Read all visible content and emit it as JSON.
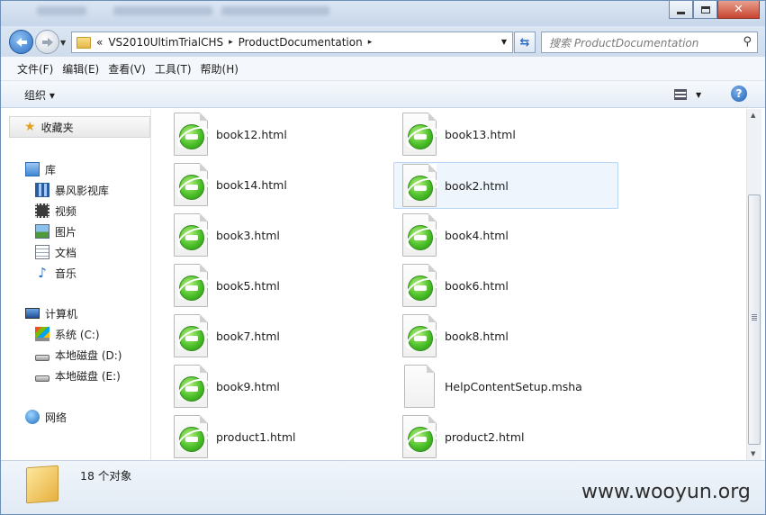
{
  "titlebar": {
    "minimize_icon": "minimize-icon",
    "maximize_icon": "maximize-icon",
    "close_icon": "close-icon"
  },
  "address": {
    "chevrons": "«",
    "crumbs": [
      "VS2010UltimTrialCHS",
      "ProductDocumentation"
    ],
    "separator": "▸"
  },
  "search": {
    "placeholder": "搜索 ProductDocumentation"
  },
  "menu": {
    "file": "文件(F)",
    "edit": "编辑(E)",
    "view": "查看(V)",
    "tools": "工具(T)",
    "help": "帮助(H)"
  },
  "toolbar": {
    "organize": "组织 ▾"
  },
  "nav": {
    "favorites": "收藏夹",
    "libraries": "库",
    "lib_items": [
      "暴风影视库",
      "视频",
      "图片",
      "文档",
      "音乐"
    ],
    "computer": "计算机",
    "drives": [
      "系统 (C:)",
      "本地磁盘 (D:)",
      "本地磁盘 (E:)"
    ],
    "network": "网络"
  },
  "files": [
    {
      "name": "book12.html",
      "type": "html"
    },
    {
      "name": "book13.html",
      "type": "html"
    },
    {
      "name": "book14.html",
      "type": "html"
    },
    {
      "name": "book2.html",
      "type": "html",
      "selected": true
    },
    {
      "name": "book3.html",
      "type": "html"
    },
    {
      "name": "book4.html",
      "type": "html"
    },
    {
      "name": "book5.html",
      "type": "html"
    },
    {
      "name": "book6.html",
      "type": "html"
    },
    {
      "name": "book7.html",
      "type": "html"
    },
    {
      "name": "book8.html",
      "type": "html"
    },
    {
      "name": "book9.html",
      "type": "html"
    },
    {
      "name": "HelpContentSetup.msha",
      "type": "generic"
    },
    {
      "name": "product1.html",
      "type": "html"
    },
    {
      "name": "product2.html",
      "type": "html"
    }
  ],
  "status": {
    "count": "18 个对象"
  },
  "watermark": "www.wooyun.org"
}
